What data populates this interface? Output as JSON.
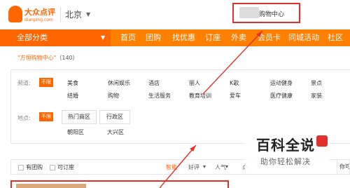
{
  "header": {
    "logo_cn": "大众点评",
    "logo_en": "dianping.com",
    "city": "北京",
    "search_value": "购物中心"
  },
  "nav": {
    "category_label": "全部分类",
    "items": [
      "首页",
      "团购",
      "找优惠",
      "订座",
      "外卖",
      "会员卡",
      "同城活动",
      "社区"
    ]
  },
  "breadcrumb": {
    "query": "\"方恒购物中心\"",
    "count": "（140）"
  },
  "filters": {
    "channel_label": "频道:",
    "area_label": "地点:",
    "any_tag": "不限",
    "channels_row1": [
      "美食",
      "休闲娱乐",
      "酒店",
      "丽人",
      "K歌",
      "运动健身",
      "景点"
    ],
    "channels_row2": [
      "结婚",
      "购物",
      "生活服务",
      "教育培训",
      "爱车",
      "医疗健康",
      "家装"
    ],
    "area_row1": [
      "热门商区",
      "行政区"
    ],
    "area_row2": [
      "朝阳区",
      "大兴区"
    ]
  },
  "sortbar": {
    "group_buy": "有团购",
    "reservable": "可订座",
    "sorts": [
      "智能",
      "好评",
      "人气",
      "点"
    ]
  },
  "side_tab": "你可",
  "watermark": {
    "title": "百科全说",
    "subtitle": "助你轻松解决"
  },
  "colors": {
    "brand_orange": "#ff6600",
    "nav_orange": "#ff7f00",
    "highlight_red": "#e0322b"
  }
}
